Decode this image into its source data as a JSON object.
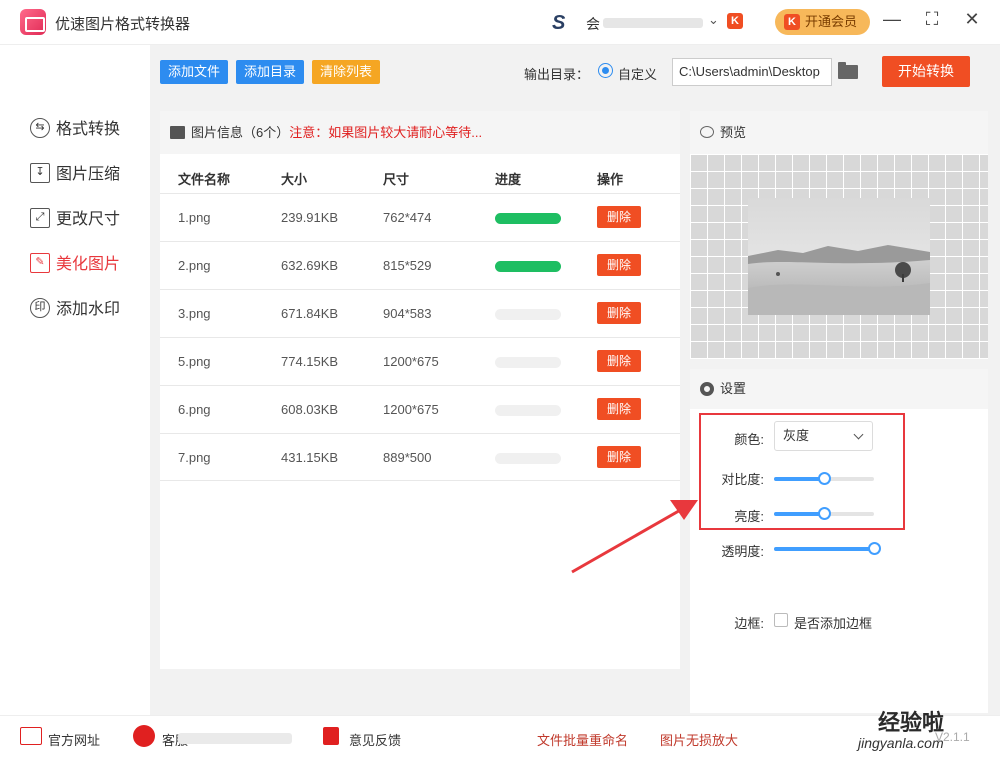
{
  "app": {
    "title": "优速图片格式转换器",
    "user_name": "会"
  },
  "vip": {
    "badge": "K",
    "label": "开通会员"
  },
  "window": {
    "minimize": "—",
    "maximize": "⛶",
    "close": "✕",
    "user_dropdown": "⌄"
  },
  "sidebar": {
    "items": [
      {
        "label": "格式转换",
        "icon": "convert-icon",
        "glyph": "⇆",
        "active": false
      },
      {
        "label": "图片压缩",
        "icon": "compress-icon",
        "glyph": "↧",
        "active": false
      },
      {
        "label": "更改尺寸",
        "icon": "resize-icon",
        "glyph": "⤢",
        "active": false
      },
      {
        "label": "美化图片",
        "icon": "beautify-icon",
        "glyph": "✎",
        "active": true
      },
      {
        "label": "添加水印",
        "icon": "watermark-icon",
        "glyph": "印",
        "active": false
      }
    ]
  },
  "toolbar": {
    "add_file": "添加文件",
    "add_dir": "添加目录",
    "clear_list": "清除列表",
    "output_label": "输出目录：",
    "radio_label": "自定义",
    "output_path": "C:\\Users\\admin\\Desktop",
    "start": "开始转换"
  },
  "file_panel": {
    "header": "图片信息（6个）",
    "notice": "注意：如果图片较大请耐心等待...",
    "columns": [
      "文件名称",
      "大小",
      "尺寸",
      "进度",
      "操作"
    ],
    "rows": [
      {
        "name": "1.png",
        "size": "239.91KB",
        "dim": "762*474",
        "progress": 1,
        "action": "删除"
      },
      {
        "name": "2.png",
        "size": "632.69KB",
        "dim": "815*529",
        "progress": 1,
        "action": "删除"
      },
      {
        "name": "3.png",
        "size": "671.84KB",
        "dim": "904*583",
        "progress": 0,
        "action": "删除"
      },
      {
        "name": "5.png",
        "size": "774.15KB",
        "dim": "1200*675",
        "progress": 0,
        "action": "删除"
      },
      {
        "name": "6.png",
        "size": "608.03KB",
        "dim": "1200*675",
        "progress": 0,
        "action": "删除"
      },
      {
        "name": "7.png",
        "size": "431.15KB",
        "dim": "889*500",
        "progress": 0,
        "action": "删除"
      }
    ]
  },
  "preview": {
    "title": "预览"
  },
  "settings": {
    "title": "设置",
    "color_label": "颜色:",
    "color_value": "灰度",
    "contrast_label": "对比度:",
    "contrast_value": 0.5,
    "brightness_label": "亮度:",
    "brightness_value": 0.5,
    "opacity_label": "透明度:",
    "opacity_value": 1.0,
    "border_label": "边框:",
    "border_checkbox": "是否添加边框"
  },
  "footer": {
    "website": "官方网址",
    "service": "客服",
    "feedback": "意见反馈",
    "batch_rename": "文件批量重命名",
    "enlarge": "图片无损放大"
  },
  "watermark": {
    "brand": "经验啦",
    "url": "jingyanla.com",
    "version": "V2.1.1"
  },
  "colors": {
    "accent_red": "#f04e23",
    "accent_blue": "#2d8cf0",
    "progress_green": "#1ebe62",
    "active_red": "#e8383d"
  }
}
